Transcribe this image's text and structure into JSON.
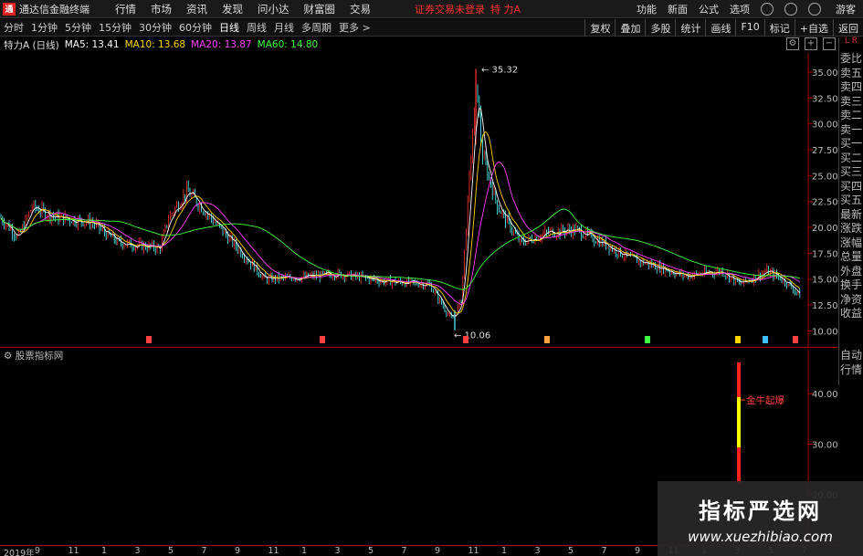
{
  "titlebar": {
    "logo": "通",
    "app_name": "通达信金融终端",
    "menus": [
      "行情",
      "市场",
      "资讯",
      "发现",
      "问小达",
      "财富圈",
      "交易"
    ],
    "notice": "证券交易未登录",
    "stock": "特 力A",
    "right_menus": [
      "功能",
      "新面",
      "公式",
      "选项"
    ],
    "guest": "游客"
  },
  "toolbar": {
    "periods": [
      "分时",
      "1分钟",
      "5分钟",
      "15分钟",
      "30分钟",
      "60分钟",
      "日线",
      "周线",
      "月线",
      "多周期",
      "更多 >"
    ],
    "active": "日线",
    "right_buttons": [
      "复权",
      "叠加",
      "多股",
      "统计",
      "画线",
      "F10",
      "标记",
      "+自选",
      "返回"
    ]
  },
  "info": {
    "name": "特力A (日线)",
    "ma": [
      {
        "label": "MA5: 13.41",
        "color": "#ffffff"
      },
      {
        "label": "MA10: 13.68",
        "color": "#ffd400"
      },
      {
        "label": "MA20: 13.87",
        "color": "#ff40ff"
      },
      {
        "label": "MA60: 14.80",
        "color": "#40ff40"
      }
    ]
  },
  "sidepanel": {
    "top": "L R",
    "items": [
      "委比",
      "卖五",
      "卖四",
      "卖三",
      "卖二",
      "卖一",
      "买一",
      "买二",
      "买三",
      "买四",
      "买五",
      "最新",
      "涨跌",
      "涨幅",
      "总量",
      "外盘",
      "换手",
      "净资",
      "收益"
    ],
    "lower": [
      "自动",
      "行情"
    ]
  },
  "chart_data": {
    "type": "candlestick",
    "yaxis_labels": [
      "35.00",
      "32.50",
      "30.00",
      "27.50",
      "25.00",
      "22.50",
      "20.00",
      "17.50",
      "15.00",
      "12.50",
      "10.00"
    ],
    "ylim": [
      8.8,
      36.5
    ],
    "max_label": "35.32",
    "min_label": "10.06",
    "x_ticks": [
      "2019年",
      "9",
      "11",
      "1",
      "3",
      "5",
      "7",
      "9",
      "11",
      "1",
      "3",
      "5",
      "7",
      "9",
      "11",
      "1",
      "3",
      "5",
      "7",
      "9",
      "11",
      "1",
      "3",
      "5",
      "7"
    ]
  },
  "indicator": {
    "title": "股票指标网",
    "yaxis_labels": [
      "40.00",
      "30.00",
      "20.00"
    ],
    "signal": "金牛起爆"
  },
  "watermark": {
    "title": "指标严选网",
    "url": "www.xuezhibiao.com"
  }
}
